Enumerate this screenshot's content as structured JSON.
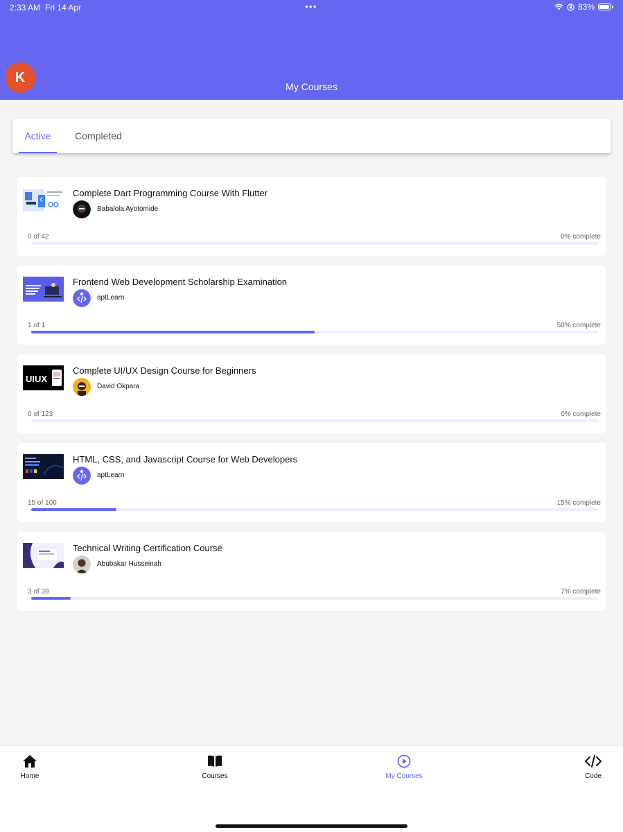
{
  "status_bar": {
    "time": "2:33 AM",
    "date": "Fri 14 Apr",
    "dots": "•••",
    "battery": "83%"
  },
  "header": {
    "avatar_initial": "K",
    "title": "My Courses"
  },
  "tabs": [
    {
      "label": "Active",
      "active": true
    },
    {
      "label": "Completed",
      "active": false
    }
  ],
  "courses": [
    {
      "title": "Complete Dart Programming Course With Flutter",
      "instructor": "Babalola Ayotomide",
      "progress_text": "0 of 42",
      "percent_text": "0% complete",
      "progress": 0
    },
    {
      "title": "Frontend Web Development Scholarship Examination",
      "instructor": "aptLearn",
      "progress_text": "1 of 1",
      "percent_text": "50% complete",
      "progress": 50
    },
    {
      "title": "Complete UI/UX Design Course for Beginners",
      "instructor": "David Okpara",
      "progress_text": "0 of 123",
      "percent_text": "0% complete",
      "progress": 0,
      "thumb_text": "UIUX"
    },
    {
      "title": "HTML, CSS, and Javascript Course for Web Developers",
      "instructor": "aptLearn",
      "progress_text": "15 of 100",
      "percent_text": "15% complete",
      "progress": 15
    },
    {
      "title": "Technical Writing Certification Course",
      "instructor": "Abubakar Husseinah",
      "progress_text": "3 of 39",
      "percent_text": "7% complete",
      "progress": 7
    }
  ],
  "bottom_nav": [
    {
      "label": "Home",
      "icon": "home-icon",
      "active": false
    },
    {
      "label": "Courses",
      "icon": "book-icon",
      "active": false
    },
    {
      "label": "My Courses",
      "icon": "play-circle-icon",
      "active": true
    },
    {
      "label": "Code",
      "icon": "code-icon",
      "active": false
    }
  ],
  "colors": {
    "brand": "#6467f0",
    "avatar": "#e3522d",
    "background": "#f4f4f4"
  }
}
